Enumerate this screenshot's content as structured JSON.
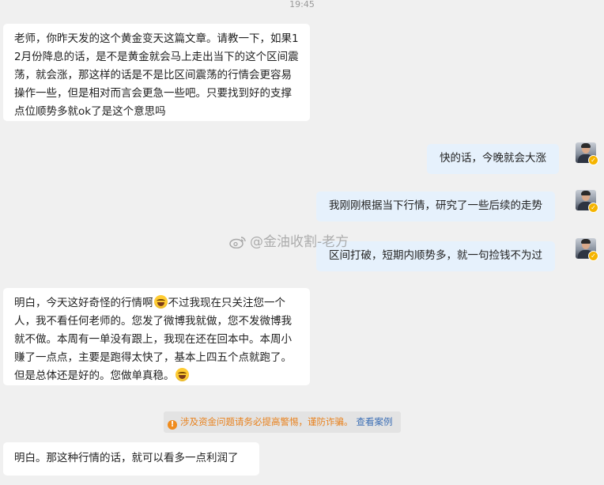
{
  "timestamp": "19:45",
  "messages": [
    {
      "direction": "in",
      "text": "老师，你昨天发的这个黄金变天这篇文章。请教一下，如果12月份降息的话，是不是黄金就会马上走出当下的这个区间震荡，就会涨，那这样的话是不是比区间震荡的行情会更容易操作一些，但是相对而言会更急一些吧。只要找到好的支撑点位顺势多就ok了是这个意思吗"
    },
    {
      "direction": "out",
      "text": "快的话，今晚就会大涨"
    },
    {
      "direction": "out",
      "text": "我刚刚根据当下行情，研究了一些后续的走势"
    },
    {
      "direction": "out",
      "text": "区间打破，短期内顺势多，就一句捡钱不为过"
    },
    {
      "direction": "in",
      "text_a": "明白，今天这好奇怪的行情啊",
      "emoji_a": "grinning-sweat-emoji",
      "text_b": "不过我现在只关注您一个人，我不看任何老师的。您发了微博我就做，您不发微博我就不做。本周有一单没有跟上，我现在还在回本中。本周小赚了一点点，主要是跑得太快了，基本上四五个点就跑了。但是总体还是好的。您做单真稳。",
      "emoji_b": "grinning-sweat-emoji"
    },
    {
      "direction": "in",
      "text": "明白。那这种行情的话，就可以看多一点利润了"
    }
  ],
  "notice": {
    "icon": "warning-icon",
    "text": "涉及资金问题请务必提高警惕，谨防诈骗。",
    "link": "查看案例",
    "text_color": "#e8811c",
    "link_color": "#3c6fb5"
  },
  "watermark": "@金油收割-老方",
  "colors": {
    "background": "#f0f0f0",
    "incoming_bubble": "#ffffff",
    "outgoing_bubble": "#e6f1fc",
    "verified_badge": "#f5b400"
  }
}
